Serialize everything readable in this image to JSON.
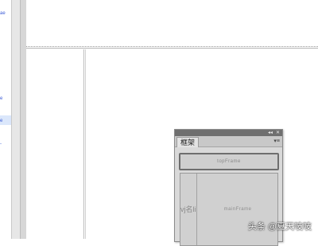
{
  "left_panel": {
    "fragment_top": "ae",
    "fragment_mid": "e",
    "fragment_sel": "e",
    "fragment_low": "-"
  },
  "frames_panel": {
    "tab_label": "框架",
    "menu_icon": "panel-menu-icon",
    "collapse_label": "◂◂",
    "close_label": "✕",
    "top_frame_label": "topFrame",
    "left_frame_label": "lvj名li",
    "main_frame_label": "mainFrame"
  },
  "watermark": "头条 @夏天吱吱"
}
